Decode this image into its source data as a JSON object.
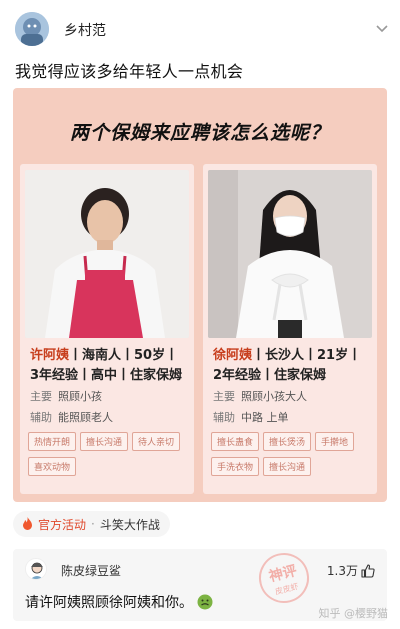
{
  "post": {
    "username": "乡村范",
    "text": "我觉得应该多给年轻人一点机会"
  },
  "image": {
    "title": "两个保姆来应聘该怎么选呢？",
    "left": {
      "name": "许阿姨",
      "info1_rest": "丨海南人丨50岁丨",
      "info2": "3年经验丨高中丨住家保姆",
      "duty_main_key": "主要",
      "duty_main_val": "照顾小孩",
      "duty_aux_key": "辅助",
      "duty_aux_val": "能照顾老人",
      "tags": [
        "热情开朗",
        "擅长沟通",
        "待人亲切",
        "喜欢动物"
      ]
    },
    "right": {
      "name": "徐阿姨",
      "info1_rest": "丨长沙人丨21岁丨",
      "info2": "2年经验丨住家保姆",
      "duty_main_key": "主要",
      "duty_main_val": "照顾小孩大人",
      "duty_aux_key": "辅助",
      "duty_aux_val": "中路  上单",
      "tags": [
        "擅长蛊食",
        "擅长煲汤",
        "手擀地",
        "手洗衣物",
        "擅长沟通"
      ]
    }
  },
  "activity": {
    "label": "官方活动",
    "dot": "·",
    "topic": "斗笑大作战"
  },
  "comment": {
    "username": "陈皮绿豆鲨",
    "stamp_main": "神评",
    "stamp_sub": "皮皮虾",
    "likes": "1.3万",
    "text": "请许阿姨照顾徐阿姨和你。"
  },
  "watermark": "知乎 @樱野猫",
  "icons": {
    "more": "chevron-down-icon",
    "fire": "fire-icon",
    "like": "thumbs-up-icon",
    "emoji": "sick-face-emoji-icon"
  },
  "colors": {
    "card_bg": "#f5cdbf",
    "name_accent": "#c73e1d",
    "tag_text": "#c87a6a",
    "activity_accent": "#e04a2d"
  }
}
